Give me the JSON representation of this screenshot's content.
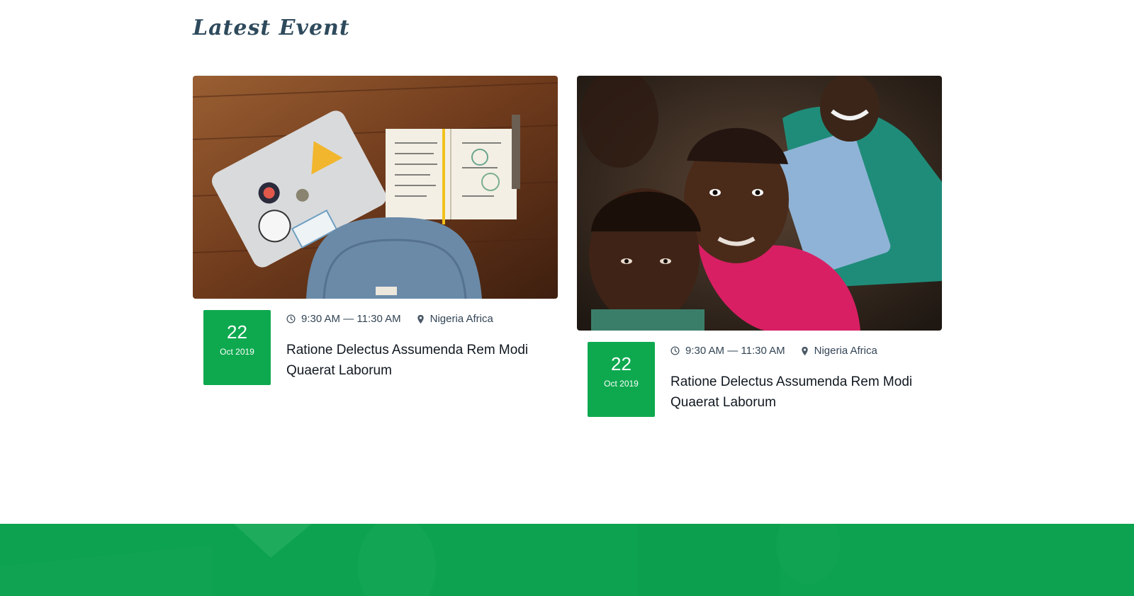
{
  "section": {
    "title": "Latest Event"
  },
  "events": [
    {
      "image_icon": "laptop-notebook-backpack-photo",
      "day": "22",
      "month_year": "Oct 2019",
      "time": "9:30 AM — 11:30 AM",
      "location": "Nigeria Africa",
      "title": "Ratione Delectus Assumenda Rem Modi Quaerat Laborum"
    },
    {
      "image_icon": "children-portrait-photo",
      "day": "22",
      "month_year": "Oct 2019",
      "time": "9:30 AM — 11:30 AM",
      "location": "Nigeria Africa",
      "title": "Ratione Delectus Assumenda Rem Modi Quaerat Laborum"
    }
  ],
  "colors": {
    "accent_green": "#0ea94f",
    "title_color": "#2e4a5c",
    "text_dark": "#111820"
  },
  "icons": {
    "time": "clock-icon",
    "location": "map-pin-icon"
  }
}
